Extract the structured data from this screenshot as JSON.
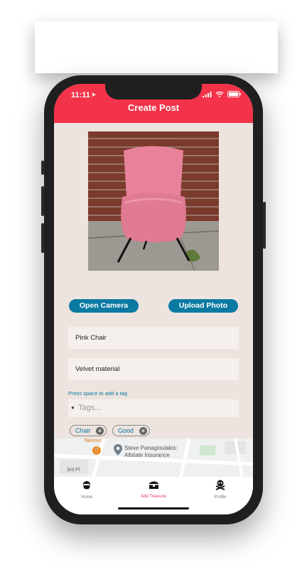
{
  "status_bar": {
    "time": "11:11"
  },
  "header": {
    "title": "Create Post"
  },
  "buttons": {
    "open_camera": "Open Camera",
    "upload_photo": "Upload Photo"
  },
  "form": {
    "title_value": "Pink Chair",
    "description_value": "Velvet material",
    "tag_hint": "Press space to add a tag",
    "tags_placeholder": "Tags..."
  },
  "tags": [
    "Chair",
    "Good"
  ],
  "map": {
    "poi_takeout": "Takeout",
    "place_line1": "Steve Panagioulakis:",
    "place_line2": "Allstate Insurance",
    "street": "3rd Pl"
  },
  "tabbar": {
    "home": "Home",
    "add_treasure": "Add Treasure",
    "profile": "Profile"
  },
  "colors": {
    "header": "#f2334a",
    "accent": "#0a7aa2",
    "active_tab": "#e0356b",
    "background": "#ede4df"
  }
}
